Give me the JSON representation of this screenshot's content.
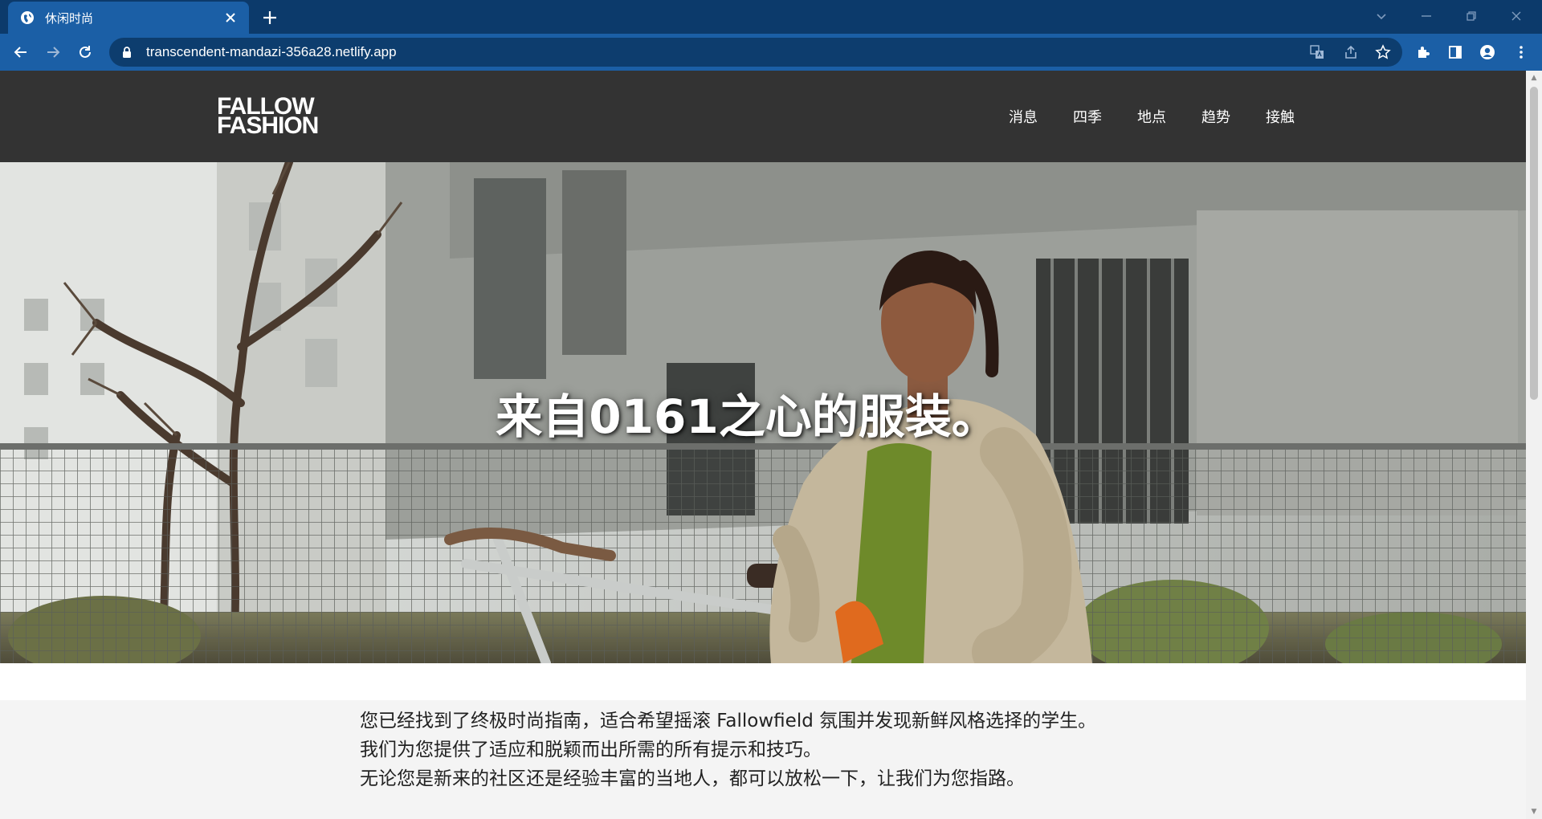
{
  "browser": {
    "tab_title": "休闲时尚",
    "url": "transcendent-mandazi-356a28.netlify.app"
  },
  "site": {
    "logo_line1": "FALLOW",
    "logo_line2": "FASHION",
    "nav": [
      "消息",
      "四季",
      "地点",
      "趋势",
      "接触"
    ]
  },
  "hero": {
    "title": "来自0161之心的服装。"
  },
  "intro": {
    "lines": [
      "您已经找到了终极时尚指南，适合希望摇滚 Fallowfield 氛围并发现新鲜风格选择的学生。",
      "我们为您提供了适应和脱颖而出所需的所有提示和技巧。",
      "无论您是新来的社区还是经验丰富的当地人，都可以放松一下，让我们为您指路。"
    ]
  },
  "colors": {
    "tabstrip": "#0c3a6b",
    "toolbar": "#1b5fa6",
    "omnibox": "#0d3d6e",
    "site_header": "#333333",
    "page_bg": "#f4f4f4"
  }
}
